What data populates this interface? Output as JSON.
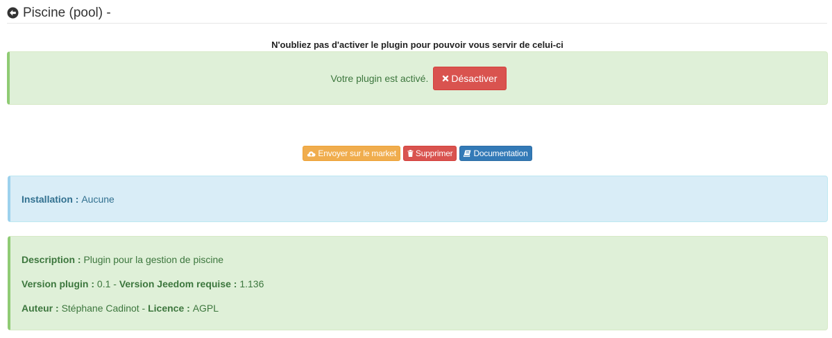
{
  "header": {
    "title": "Piscine (pool) -",
    "back_icon": "arrow-circle-left-icon"
  },
  "activation": {
    "hint": "N'oubliez pas d'activer le plugin pour pouvoir vous servir de celui-ci",
    "status_text": "Votre plugin est activé.",
    "deactivate_label": "Désactiver",
    "deactivate_icon": "times-icon"
  },
  "actions": {
    "market_label": "Envoyer sur le market",
    "market_icon": "cloud-upload-icon",
    "delete_label": "Supprimer",
    "delete_icon": "trash-icon",
    "docs_label": "Documentation",
    "docs_icon": "book-icon"
  },
  "installation": {
    "label": "Installation :",
    "value": "Aucune"
  },
  "details": {
    "description_label": "Description :",
    "description_value": "Plugin pour la gestion de piscine",
    "version_label": "Version plugin :",
    "version_value": "0.1",
    "separator": "-",
    "jeedom_label": "Version Jeedom requise :",
    "jeedom_value": "1.136",
    "author_label": "Auteur :",
    "author_value": "Stéphane Cadinot",
    "licence_label": "Licence :",
    "licence_value": "AGPL"
  },
  "colors": {
    "success_bg": "#dff0d8",
    "success_text": "#3c763d",
    "info_bg": "#d9edf7",
    "info_text": "#31708f",
    "danger": "#d9534f",
    "warning": "#f0ad4e",
    "primary": "#337ab7"
  }
}
